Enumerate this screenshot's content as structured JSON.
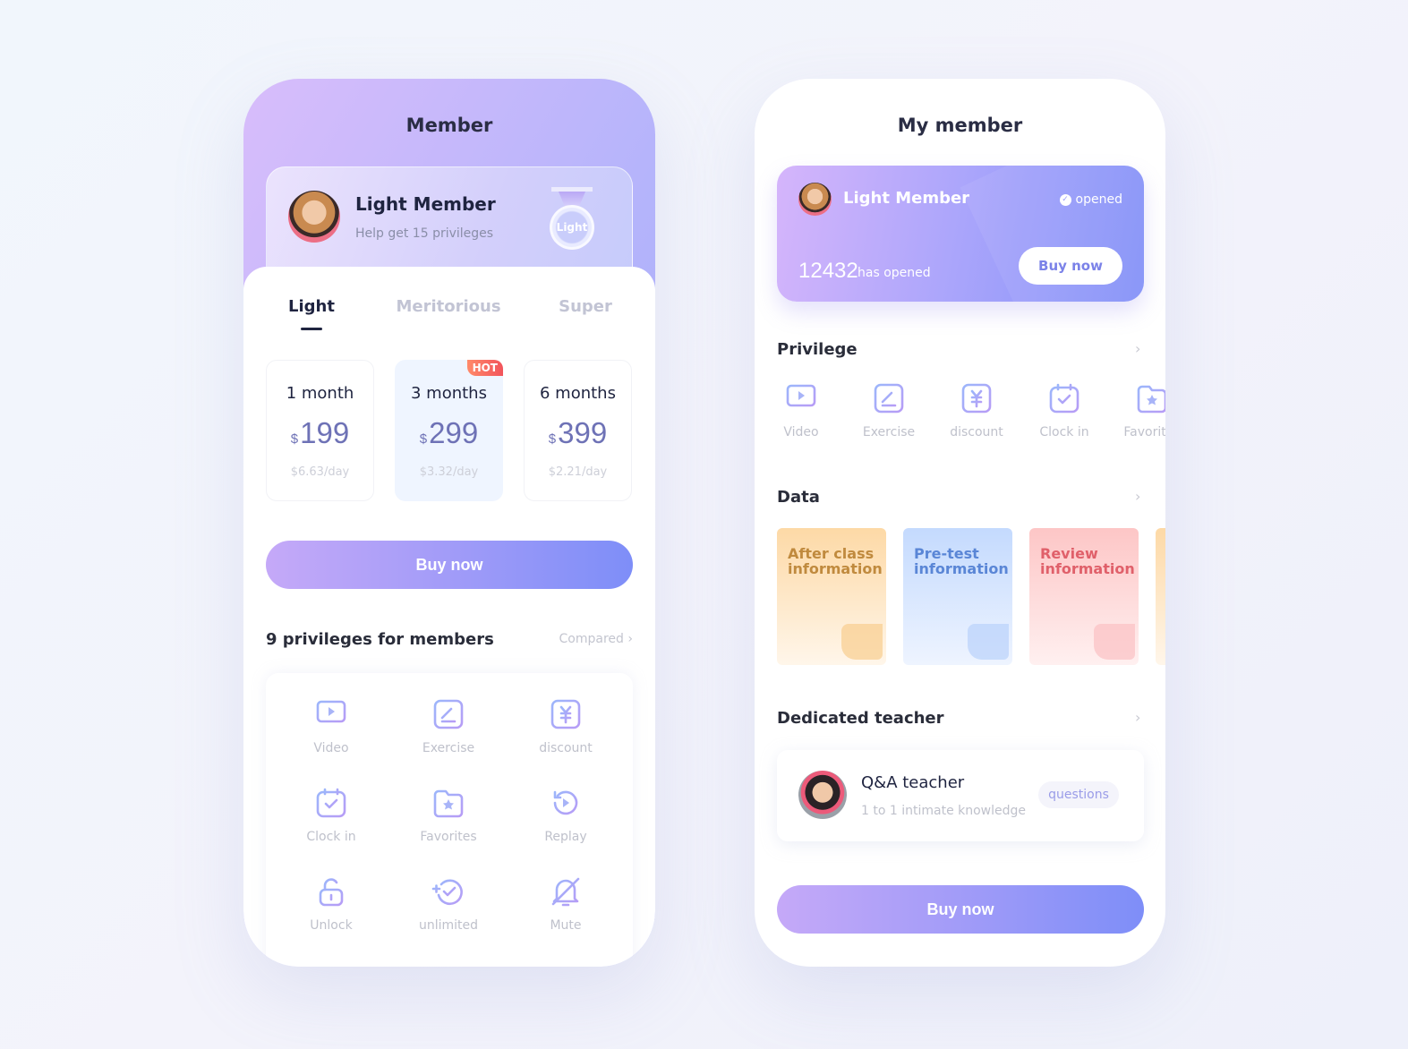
{
  "member_screen": {
    "title": "Member",
    "card": {
      "name": "Light Member",
      "subtitle": "Help get 15 privileges",
      "badge": "Light"
    },
    "tabs": [
      {
        "label": "Light",
        "active": true
      },
      {
        "label": "Meritorious",
        "active": false
      },
      {
        "label": "Super",
        "active": false
      }
    ],
    "plans": [
      {
        "duration": "1 month",
        "currency": "$",
        "price": "199",
        "per_day": "$6.63/day",
        "selected": false
      },
      {
        "duration": "3 months",
        "currency": "$",
        "price": "299",
        "per_day": "$3.32/day",
        "selected": true,
        "badge": "HOT"
      },
      {
        "duration": "6 months",
        "currency": "$",
        "price": "399",
        "per_day": "$2.21/day",
        "selected": false
      }
    ],
    "buy_label": "Buy now",
    "privileges_title": "9 privileges for members",
    "compared_label": "Compared",
    "privileges": [
      {
        "label": "Video",
        "icon": "video-icon"
      },
      {
        "label": "Exercise",
        "icon": "exercise-icon"
      },
      {
        "label": "discount",
        "icon": "discount-icon"
      },
      {
        "label": "Clock in",
        "icon": "clock-in-icon"
      },
      {
        "label": "Favorites",
        "icon": "favorites-icon"
      },
      {
        "label": "Replay",
        "icon": "replay-icon"
      },
      {
        "label": "Unlock",
        "icon": "unlock-icon"
      },
      {
        "label": "unlimited",
        "icon": "unlimited-icon"
      },
      {
        "label": "Mute",
        "icon": "mute-icon"
      }
    ]
  },
  "my_member_screen": {
    "title": "My member",
    "card": {
      "name": "Light Member",
      "status": "opened",
      "count": "12432",
      "count_label": "has opened",
      "buy_label": "Buy now"
    },
    "privilege_title": "Privilege",
    "privileges": [
      {
        "label": "Video",
        "icon": "video-icon"
      },
      {
        "label": "Exercise",
        "icon": "exercise-icon"
      },
      {
        "label": "discount",
        "icon": "discount-icon"
      },
      {
        "label": "Clock in",
        "icon": "clock-in-icon"
      },
      {
        "label": "Favorites",
        "icon": "favorites-icon"
      }
    ],
    "data_title": "Data",
    "data_cards": [
      {
        "label": "After class information",
        "color": "#c08a3e"
      },
      {
        "label": "Pre-test information",
        "color": "#5a86d6"
      },
      {
        "label": "Review information",
        "color": "#e0606a"
      }
    ],
    "teacher_title": "Dedicated teacher",
    "teacher": {
      "name": "Q&A teacher",
      "subtitle": "1 to 1 intimate knowledge",
      "tag": "questions"
    },
    "buy_label": "Buy now"
  },
  "colors": {
    "accent_start": "#c5a9f8",
    "accent_end": "#7e8ef8",
    "price": "#6e72b6",
    "hot": "#f2545b"
  }
}
